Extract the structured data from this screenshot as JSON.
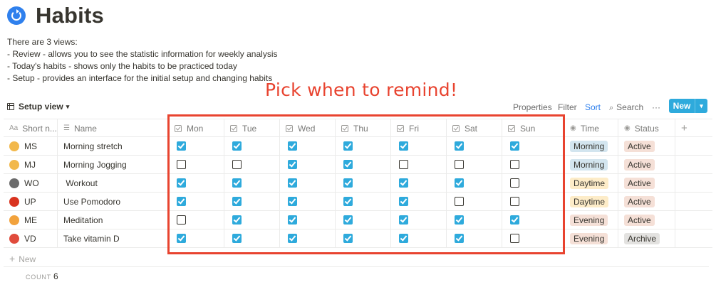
{
  "page": {
    "icon": "circular-arrow-icon",
    "title": "Habits",
    "description": [
      "There are 3 views:",
      "- Review - allows you to see the statistic information for weekly analysis",
      "- Today's habits - shows only the habits to be practiced today",
      "- Setup - provides an interface for the initial setup and changing habits"
    ]
  },
  "annotation": {
    "text": "Pick when to remind!",
    "color": "#e8432f"
  },
  "toolbar": {
    "view_label": "Setup view",
    "properties": "Properties",
    "filter": "Filter",
    "sort": "Sort",
    "search": "Search",
    "more": "···",
    "new_label": "New"
  },
  "columns": {
    "short_name": "Short n...",
    "name": "Name",
    "days": [
      "Mon",
      "Tue",
      "Wed",
      "Thu",
      "Fri",
      "Sat",
      "Sun"
    ],
    "time": "Time",
    "status": "Status",
    "add": "+"
  },
  "rows": [
    {
      "emoji": "stretching-person-icon",
      "short": "MS",
      "name": "Morning stretch",
      "days": [
        true,
        true,
        true,
        true,
        true,
        true,
        true
      ],
      "time": "Morning",
      "status": "Active"
    },
    {
      "emoji": "running-person-icon",
      "short": "MJ",
      "name": "Morning Jogging",
      "days": [
        false,
        false,
        true,
        true,
        false,
        false,
        false
      ],
      "time": "Morning",
      "status": "Active"
    },
    {
      "emoji": "weightlifter-icon",
      "short": "WO",
      "name": " Workout",
      "days": [
        true,
        true,
        true,
        true,
        true,
        true,
        false
      ],
      "time": "Daytime",
      "status": "Active"
    },
    {
      "emoji": "tomato-icon",
      "short": "UP",
      "name": "Use Pomodoro",
      "days": [
        true,
        true,
        true,
        true,
        true,
        false,
        false
      ],
      "time": "Daytime",
      "status": "Active"
    },
    {
      "emoji": "meditation-person-icon",
      "short": "ME",
      "name": "Meditation",
      "days": [
        false,
        true,
        true,
        true,
        true,
        true,
        true
      ],
      "time": "Evening",
      "status": "Active"
    },
    {
      "emoji": "pill-icon",
      "short": "VD",
      "name": "Take vitamin D",
      "days": [
        true,
        true,
        true,
        true,
        true,
        true,
        false
      ],
      "time": "Evening",
      "status": "Archive"
    }
  ],
  "tag_colors": {
    "Morning": "#d3e5ef",
    "Daytime": "#fdecc8",
    "Evening": "#f5e0d7",
    "Active": "#f5e0d7",
    "Archive": "#e3e2e0"
  },
  "emoji_colors": {
    "stretching-person-icon": "#f2b84b",
    "running-person-icon": "#f2b84b",
    "weightlifter-icon": "#6b6b6b",
    "tomato-icon": "#d9331f",
    "meditation-person-icon": "#f2a23c",
    "pill-icon": "#e04b3c"
  },
  "footer": {
    "new_row": "New",
    "count_label": "COUNT",
    "count_value": "6"
  }
}
